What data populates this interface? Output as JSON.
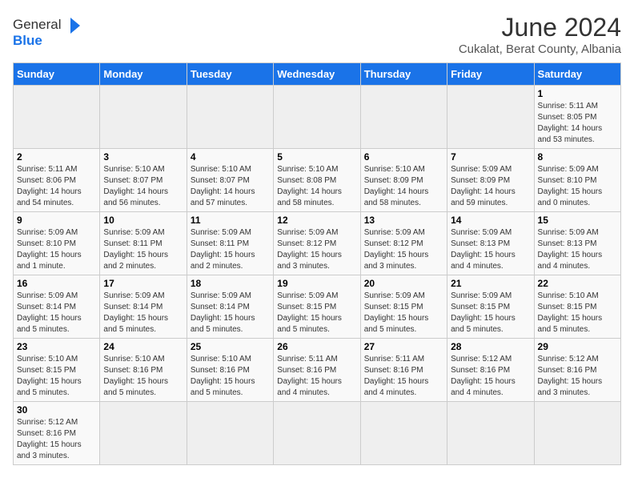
{
  "header": {
    "logo_general": "General",
    "logo_blue": "Blue",
    "month_year": "June 2024",
    "location": "Cukalat, Berat County, Albania"
  },
  "days_of_week": [
    "Sunday",
    "Monday",
    "Tuesday",
    "Wednesday",
    "Thursday",
    "Friday",
    "Saturday"
  ],
  "weeks": [
    [
      {
        "day": "",
        "empty": true
      },
      {
        "day": "",
        "empty": true
      },
      {
        "day": "",
        "empty": true
      },
      {
        "day": "",
        "empty": true
      },
      {
        "day": "",
        "empty": true
      },
      {
        "day": "",
        "empty": true
      },
      {
        "day": "1",
        "sunrise": "5:11 AM",
        "sunset": "8:05 PM",
        "daylight": "14 hours and 53 minutes."
      }
    ],
    [
      {
        "day": "2",
        "sunrise": "5:11 AM",
        "sunset": "8:06 PM",
        "daylight": "14 hours and 54 minutes."
      },
      {
        "day": "3",
        "sunrise": "5:10 AM",
        "sunset": "8:07 PM",
        "daylight": "14 hours and 56 minutes."
      },
      {
        "day": "4",
        "sunrise": "5:10 AM",
        "sunset": "8:07 PM",
        "daylight": "14 hours and 57 minutes."
      },
      {
        "day": "5",
        "sunrise": "5:10 AM",
        "sunset": "8:08 PM",
        "daylight": "14 hours and 58 minutes."
      },
      {
        "day": "6",
        "sunrise": "5:10 AM",
        "sunset": "8:09 PM",
        "daylight": "14 hours and 58 minutes."
      },
      {
        "day": "7",
        "sunrise": "5:09 AM",
        "sunset": "8:09 PM",
        "daylight": "14 hours and 59 minutes."
      },
      {
        "day": "8",
        "sunrise": "5:09 AM",
        "sunset": "8:10 PM",
        "daylight": "15 hours and 0 minutes."
      }
    ],
    [
      {
        "day": "9",
        "sunrise": "5:09 AM",
        "sunset": "8:10 PM",
        "daylight": "15 hours and 1 minute."
      },
      {
        "day": "10",
        "sunrise": "5:09 AM",
        "sunset": "8:11 PM",
        "daylight": "15 hours and 2 minutes."
      },
      {
        "day": "11",
        "sunrise": "5:09 AM",
        "sunset": "8:11 PM",
        "daylight": "15 hours and 2 minutes."
      },
      {
        "day": "12",
        "sunrise": "5:09 AM",
        "sunset": "8:12 PM",
        "daylight": "15 hours and 3 minutes."
      },
      {
        "day": "13",
        "sunrise": "5:09 AM",
        "sunset": "8:12 PM",
        "daylight": "15 hours and 3 minutes."
      },
      {
        "day": "14",
        "sunrise": "5:09 AM",
        "sunset": "8:13 PM",
        "daylight": "15 hours and 4 minutes."
      },
      {
        "day": "15",
        "sunrise": "5:09 AM",
        "sunset": "8:13 PM",
        "daylight": "15 hours and 4 minutes."
      }
    ],
    [
      {
        "day": "16",
        "sunrise": "5:09 AM",
        "sunset": "8:14 PM",
        "daylight": "15 hours and 5 minutes."
      },
      {
        "day": "17",
        "sunrise": "5:09 AM",
        "sunset": "8:14 PM",
        "daylight": "15 hours and 5 minutes."
      },
      {
        "day": "18",
        "sunrise": "5:09 AM",
        "sunset": "8:14 PM",
        "daylight": "15 hours and 5 minutes."
      },
      {
        "day": "19",
        "sunrise": "5:09 AM",
        "sunset": "8:15 PM",
        "daylight": "15 hours and 5 minutes."
      },
      {
        "day": "20",
        "sunrise": "5:09 AM",
        "sunset": "8:15 PM",
        "daylight": "15 hours and 5 minutes."
      },
      {
        "day": "21",
        "sunrise": "5:09 AM",
        "sunset": "8:15 PM",
        "daylight": "15 hours and 5 minutes."
      },
      {
        "day": "22",
        "sunrise": "5:10 AM",
        "sunset": "8:15 PM",
        "daylight": "15 hours and 5 minutes."
      }
    ],
    [
      {
        "day": "23",
        "sunrise": "5:10 AM",
        "sunset": "8:15 PM",
        "daylight": "15 hours and 5 minutes."
      },
      {
        "day": "24",
        "sunrise": "5:10 AM",
        "sunset": "8:16 PM",
        "daylight": "15 hours and 5 minutes."
      },
      {
        "day": "25",
        "sunrise": "5:10 AM",
        "sunset": "8:16 PM",
        "daylight": "15 hours and 5 minutes."
      },
      {
        "day": "26",
        "sunrise": "5:11 AM",
        "sunset": "8:16 PM",
        "daylight": "15 hours and 4 minutes."
      },
      {
        "day": "27",
        "sunrise": "5:11 AM",
        "sunset": "8:16 PM",
        "daylight": "15 hours and 4 minutes."
      },
      {
        "day": "28",
        "sunrise": "5:12 AM",
        "sunset": "8:16 PM",
        "daylight": "15 hours and 4 minutes."
      },
      {
        "day": "29",
        "sunrise": "5:12 AM",
        "sunset": "8:16 PM",
        "daylight": "15 hours and 3 minutes."
      }
    ],
    [
      {
        "day": "30",
        "sunrise": "5:12 AM",
        "sunset": "8:16 PM",
        "daylight": "15 hours and 3 minutes."
      },
      {
        "day": "",
        "empty": true
      },
      {
        "day": "",
        "empty": true
      },
      {
        "day": "",
        "empty": true
      },
      {
        "day": "",
        "empty": true
      },
      {
        "day": "",
        "empty": true
      },
      {
        "day": "",
        "empty": true
      }
    ]
  ],
  "labels": {
    "sunrise": "Sunrise:",
    "sunset": "Sunset:",
    "daylight": "Daylight:"
  }
}
